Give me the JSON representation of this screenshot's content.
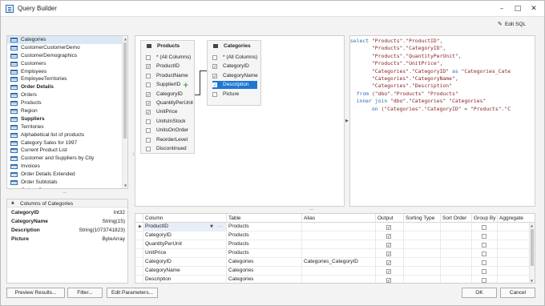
{
  "window": {
    "title": "Query Builder"
  },
  "tables": [
    {
      "label": "Categories",
      "bold": false,
      "selected": true
    },
    {
      "label": "CustomerCustomerDemo",
      "bold": false,
      "selected": false
    },
    {
      "label": "CustomerDemographics",
      "bold": false,
      "selected": false
    },
    {
      "label": "Customers",
      "bold": false,
      "selected": false
    },
    {
      "label": "Employees",
      "bold": false,
      "selected": false
    },
    {
      "label": "EmployeeTerritories",
      "bold": false,
      "selected": false
    },
    {
      "label": "Order Details",
      "bold": true,
      "selected": false
    },
    {
      "label": "Orders",
      "bold": false,
      "selected": false
    },
    {
      "label": "Products",
      "bold": false,
      "selected": false
    },
    {
      "label": "Region",
      "bold": false,
      "selected": false
    },
    {
      "label": "Suppliers",
      "bold": true,
      "selected": false
    },
    {
      "label": "Territories",
      "bold": false,
      "selected": false
    },
    {
      "label": "Alphabetical list of products",
      "bold": false,
      "selected": false
    },
    {
      "label": "Category Sales for 1997",
      "bold": false,
      "selected": false
    },
    {
      "label": "Current Product List",
      "bold": false,
      "selected": false
    },
    {
      "label": "Customer and Suppliers by City",
      "bold": false,
      "selected": false
    },
    {
      "label": "Invoices",
      "bold": false,
      "selected": false
    },
    {
      "label": "Order Details Extended",
      "bold": false,
      "selected": false
    },
    {
      "label": "Order Subtotals",
      "bold": false,
      "selected": false
    },
    {
      "label": "Orders Qry",
      "bold": false,
      "selected": false
    }
  ],
  "columns_panel": {
    "title": "Columns of Categories",
    "rows": [
      {
        "name": "CategoryID",
        "type": "Int32"
      },
      {
        "name": "CategoryName",
        "type": "String(15)"
      },
      {
        "name": "Description",
        "type": "String(1073741823)"
      },
      {
        "name": "Picture",
        "type": "ByteArray"
      }
    ]
  },
  "products_table": {
    "title": "Products",
    "columns": [
      {
        "label": "* (All Columns)",
        "checked": false
      },
      {
        "label": "ProductID",
        "checked": true
      },
      {
        "label": "ProductName",
        "checked": false
      },
      {
        "label": "SupplierID",
        "checked": false
      },
      {
        "label": "CategoryID",
        "checked": true
      },
      {
        "label": "QuantityPerUnit",
        "checked": true
      },
      {
        "label": "UnitPrice",
        "checked": true
      },
      {
        "label": "UnitsInStock",
        "checked": false
      },
      {
        "label": "UnitsOnOrder",
        "checked": false
      },
      {
        "label": "ReorderLevel",
        "checked": false
      },
      {
        "label": "Discontinued",
        "checked": false
      }
    ]
  },
  "categories_table": {
    "title": "Categories",
    "columns": [
      {
        "label": "* (All Columns)",
        "checked": false,
        "selected": false
      },
      {
        "label": "CategoryID",
        "checked": true,
        "selected": false
      },
      {
        "label": "CategoryName",
        "checked": true,
        "selected": false
      },
      {
        "label": "Description",
        "checked": true,
        "selected": true
      },
      {
        "label": "Picture",
        "checked": false,
        "selected": false
      }
    ]
  },
  "edit_sql_label": "Edit SQL",
  "sql_lines": [
    [
      {
        "t": "select ",
        "c": "kw"
      },
      {
        "t": "\"Products\".\"ProductID\",",
        "c": "tx"
      }
    ],
    [
      {
        "t": "       \"Products\".\"CategoryID\",",
        "c": "tx"
      }
    ],
    [
      {
        "t": "       \"Products\".\"QuantityPerUnit\",",
        "c": "tx"
      }
    ],
    [
      {
        "t": "       \"Products\".\"UnitPrice\",",
        "c": "tx"
      }
    ],
    [
      {
        "t": "       \"Categories\".\"CategoryID\"",
        "c": "tx"
      },
      {
        "t": " as ",
        "c": "kw"
      },
      {
        "t": "\"Categories_Cate",
        "c": "tx"
      }
    ],
    [
      {
        "t": "       \"Categories\".\"CategoryName\",",
        "c": "tx"
      }
    ],
    [
      {
        "t": "       \"Categories\".\"Description\"",
        "c": "tx"
      }
    ],
    [
      {
        "t": "  from ",
        "c": "kw"
      },
      {
        "t": "(\"dbo\".\"Products\" \"Products\"",
        "c": "tx"
      }
    ],
    [
      {
        "t": "  inner join ",
        "c": "kw"
      },
      {
        "t": "\"dbo\".\"Categories\" \"Categories\"",
        "c": "tx"
      }
    ],
    [
      {
        "t": "       on ",
        "c": "kw"
      },
      {
        "t": "(\"Categories\".\"CategoryID\" ",
        "c": "tx"
      },
      {
        "t": "= ",
        "c": "op"
      },
      {
        "t": "\"Products\".\"C",
        "c": "tx"
      }
    ]
  ],
  "grid": {
    "headers": [
      "Column",
      "Table",
      "Alias",
      "Output",
      "Sorting Type",
      "Sort Order",
      "Group By",
      "Aggregate"
    ],
    "rows": [
      {
        "column": "ProductID",
        "table": "Products",
        "alias": "",
        "output": true,
        "group_by": false,
        "current": true
      },
      {
        "column": "CategoryID",
        "table": "Products",
        "alias": "",
        "output": true,
        "group_by": false,
        "current": false
      },
      {
        "column": "QuantityPerUnit",
        "table": "Products",
        "alias": "",
        "output": true,
        "group_by": false,
        "current": false
      },
      {
        "column": "UnitPrice",
        "table": "Products",
        "alias": "",
        "output": true,
        "group_by": false,
        "current": false
      },
      {
        "column": "CategoryID",
        "table": "Categories",
        "alias": "Categories_CategoryID",
        "output": true,
        "group_by": false,
        "current": false
      },
      {
        "column": "CategoryName",
        "table": "Categories",
        "alias": "",
        "output": true,
        "group_by": false,
        "current": false
      },
      {
        "column": "Description",
        "table": "Categories",
        "alias": "",
        "output": true,
        "group_by": false,
        "current": false
      }
    ]
  },
  "buttons": {
    "preview": "Preview Results...",
    "filter": "Filter...",
    "edit_params": "Edit Parameters...",
    "ok": "OK",
    "cancel": "Cancel"
  },
  "colors": {
    "selection": "#1e78d2",
    "keyword": "#2b6cb0",
    "string": "#8a2323",
    "add_icon": "#3a9a3a"
  }
}
